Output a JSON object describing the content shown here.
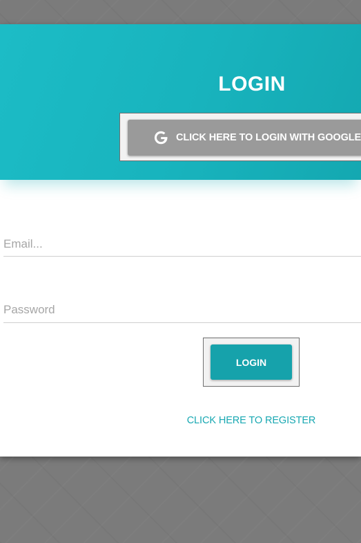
{
  "header": {
    "title": "LOGIN",
    "google_button_label": "CLICK HERE TO LOGIN WITH GOOGLE",
    "google_icon": "google-g-icon"
  },
  "form": {
    "email_placeholder": "Email...",
    "email_value": "",
    "password_placeholder": "Password",
    "password_value": "",
    "login_button_label": "LOGIN",
    "register_link_label": "CLICK HERE TO REGISTER"
  },
  "colors": {
    "header_accent": "#18b3bd",
    "primary_button": "#16a2ab",
    "google_button": "#9a9a9a",
    "link": "#18a8b2",
    "page_background": "#7b7b7b"
  }
}
